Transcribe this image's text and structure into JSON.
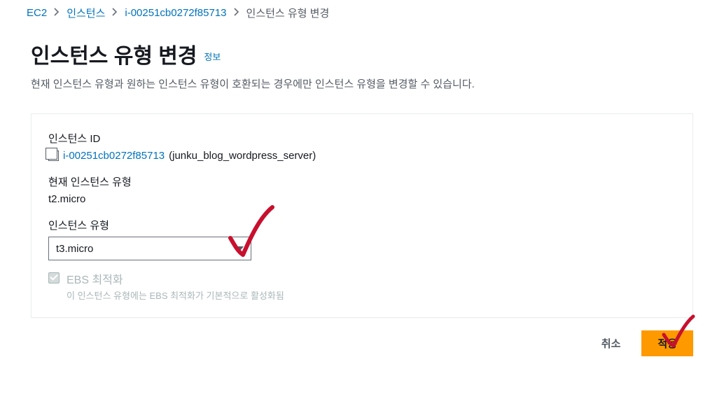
{
  "breadcrumb": {
    "items": [
      {
        "label": "EC2"
      },
      {
        "label": "인스턴스"
      },
      {
        "label": "i-00251cb0272f85713"
      }
    ],
    "current": "인스턴스 유형 변경"
  },
  "header": {
    "title": "인스턴스 유형 변경",
    "info_label": "정보",
    "description": "현재 인스턴스 유형과 원하는 인스턴스 유형이 호환되는 경우에만 인스턴스 유형을 변경할 수 있습니다."
  },
  "panel": {
    "instance_id": {
      "label": "인스턴스 ID",
      "id": "i-00251cb0272f85713",
      "name": "(junku_blog_wordpress_server)"
    },
    "current_type": {
      "label": "현재 인스턴스 유형",
      "value": "t2.micro"
    },
    "instance_type": {
      "label": "인스턴스 유형",
      "selected": "t3.micro"
    },
    "ebs": {
      "title": "EBS 최적화",
      "description": "이 인스턴스 유형에는 EBS 최적화가 기본적으로 활성화됨"
    }
  },
  "footer": {
    "cancel": "취소",
    "apply": "적용"
  }
}
